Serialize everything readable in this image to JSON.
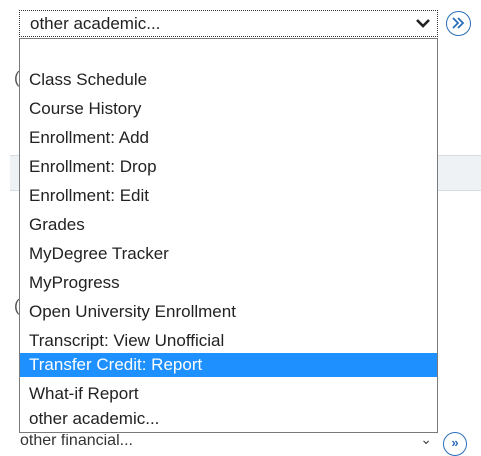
{
  "select": {
    "value": "other academic...",
    "arrow_icon": "chevron-down-icon"
  },
  "go_button": {
    "icon": "double-chevron-right-icon",
    "color": "#2a6fbb"
  },
  "listbox": {
    "selected_color": "#1e90ff",
    "options": [
      {
        "label": ""
      },
      {
        "label": "Class Schedule"
      },
      {
        "label": "Course History"
      },
      {
        "label": "Enrollment: Add"
      },
      {
        "label": "Enrollment: Drop"
      },
      {
        "label": "Enrollment: Edit"
      },
      {
        "label": "Grades"
      },
      {
        "label": "MyDegree Tracker"
      },
      {
        "label": "MyProgress"
      },
      {
        "label": "Open University Enrollment"
      },
      {
        "label": "Transcript: View Unofficial"
      },
      {
        "label": "Transfer Credit: Report",
        "selected": true
      },
      {
        "label": "What-if Report"
      },
      {
        "label": "other academic..."
      }
    ]
  },
  "background": {
    "bottom_select_value": "other financial..."
  }
}
